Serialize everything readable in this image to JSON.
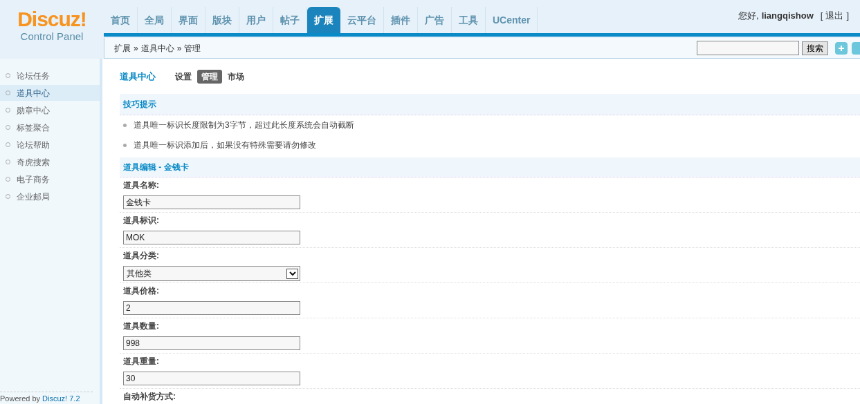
{
  "logo": {
    "name": "Discuz!",
    "subtitle": "Control Panel"
  },
  "nav_tabs": [
    {
      "label": "首页",
      "selected": false
    },
    {
      "label": "全局",
      "selected": false
    },
    {
      "label": "界面",
      "selected": false
    },
    {
      "label": "版块",
      "selected": false
    },
    {
      "label": "用户",
      "selected": false
    },
    {
      "label": "帖子",
      "selected": false
    },
    {
      "label": "扩展",
      "selected": true
    },
    {
      "label": "云平台",
      "selected": false
    },
    {
      "label": "插件",
      "selected": false
    },
    {
      "label": "广告",
      "selected": false
    },
    {
      "label": "工具",
      "selected": false
    },
    {
      "label": "UCenter",
      "selected": false
    }
  ],
  "user": {
    "greeting": "您好,",
    "username": "liangqishow",
    "bracket_open": "[",
    "logout": "退出",
    "bracket_close": "]"
  },
  "breadcrumb": [
    "扩展",
    "»",
    "道具中心",
    "»",
    "管理"
  ],
  "search": {
    "button": "搜索"
  },
  "sidebar": {
    "items": [
      {
        "label": "论坛任务",
        "selected": false
      },
      {
        "label": "道具中心",
        "selected": true
      },
      {
        "label": "勋章中心",
        "selected": false
      },
      {
        "label": "标签聚合",
        "selected": false
      },
      {
        "label": "论坛帮助",
        "selected": false
      },
      {
        "label": "奇虎搜索",
        "selected": false
      },
      {
        "label": "电子商务",
        "selected": false
      },
      {
        "label": "企业邮局",
        "selected": false
      }
    ],
    "footer": {
      "text": "Powered by",
      "link": "Discuz! 7.2"
    }
  },
  "page_title": "道具中心",
  "sub_tabs": [
    {
      "label": "设置",
      "selected": false
    },
    {
      "label": "管理",
      "selected": true
    },
    {
      "label": "市场",
      "selected": false
    }
  ],
  "tips": {
    "title": "技巧提示",
    "items": [
      "道具唯一标识长度限制为3字节，超过此长度系统会自动截断",
      "道具唯一标识添加后，如果没有特殊需要请勿修改"
    ]
  },
  "form": {
    "title": "道具编辑 - 金钱卡",
    "fields": [
      {
        "kind": "text",
        "label": "道具名称:",
        "value": "金钱卡"
      },
      {
        "kind": "text",
        "label": "道具标识:",
        "value": "MOK"
      },
      {
        "kind": "select",
        "label": "道具分类:",
        "value": "其他类"
      },
      {
        "kind": "text",
        "label": "道具价格:",
        "value": "2"
      },
      {
        "kind": "text",
        "label": "道具数量:",
        "value": "998"
      },
      {
        "kind": "text",
        "label": "道具重量:",
        "value": "30"
      },
      {
        "kind": "label",
        "label": "自动补货方式:"
      }
    ]
  }
}
